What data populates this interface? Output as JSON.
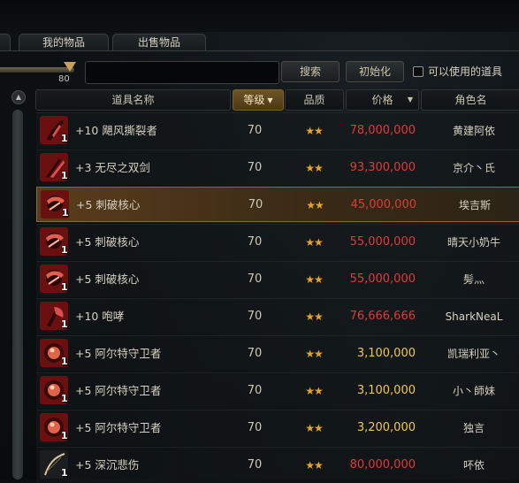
{
  "tabs": [
    {
      "label": "我的物品"
    },
    {
      "label": "出售物品"
    }
  ],
  "filters": {
    "level_slider_value": "80",
    "search_value": "",
    "search_button": "搜索",
    "reset_button": "初始化",
    "usable_only_label": "可以使用的道具",
    "usable_only_checked": false
  },
  "columns": {
    "name": "道具名称",
    "level": "等级",
    "quality": "品质",
    "price": "价格",
    "seller": "角色名"
  },
  "colors": {
    "price_high": "#e13a3a",
    "price_low": "#f0c84a",
    "stars": "#e3a52c",
    "selected_row": "#5b3e1b"
  },
  "rows": [
    {
      "name": "+10 飓风撕裂者",
      "level": "70",
      "quality": "★★",
      "price": "78,000,000",
      "seller": "黄建阿依",
      "qty": "1",
      "icon": "claw-weapon-icon"
    },
    {
      "name": "+3 无尽之双剑",
      "level": "70",
      "quality": "★★",
      "price": "93,300,000",
      "seller": "京介丶氏",
      "qty": "1",
      "icon": "twin-blades-icon"
    },
    {
      "name": "+5 刺破核心",
      "level": "70",
      "quality": "★★",
      "price": "45,000,000",
      "seller": "埃吉斯",
      "qty": "1",
      "icon": "core-weapon-icon"
    },
    {
      "name": "+5 刺破核心",
      "level": "70",
      "quality": "★★",
      "price": "55,000,000",
      "seller": "晴天小奶牛",
      "qty": "1",
      "icon": "core-weapon-icon"
    },
    {
      "name": "+5 刺破核心",
      "level": "70",
      "quality": "★★",
      "price": "55,000,000",
      "seller": "髣灬",
      "qty": "1",
      "icon": "core-weapon-icon"
    },
    {
      "name": "+10 咆哮",
      "level": "70",
      "quality": "★★",
      "price": "76,666,666",
      "seller": "SharkNeaL",
      "qty": "1",
      "icon": "axe-weapon-icon"
    },
    {
      "name": "+5 阿尔特守卫者",
      "level": "70",
      "quality": "★★",
      "price": "3,100,000",
      "seller": "凯瑞利亚丶",
      "qty": "1",
      "icon": "guardian-orb-icon"
    },
    {
      "name": "+5 阿尔特守卫者",
      "level": "70",
      "quality": "★★",
      "price": "3,100,000",
      "seller": "小丶師妹",
      "qty": "1",
      "icon": "guardian-orb-icon"
    },
    {
      "name": "+5 阿尔特守卫者",
      "level": "70",
      "quality": "★★",
      "price": "3,200,000",
      "seller": "独言",
      "qty": "1",
      "icon": "guardian-orb-icon"
    },
    {
      "name": "+5 深沉悲伤",
      "level": "70",
      "quality": "★★",
      "price": "80,000,000",
      "seller": "吥依",
      "qty": "1",
      "icon": "bow-weapon-icon"
    }
  ]
}
